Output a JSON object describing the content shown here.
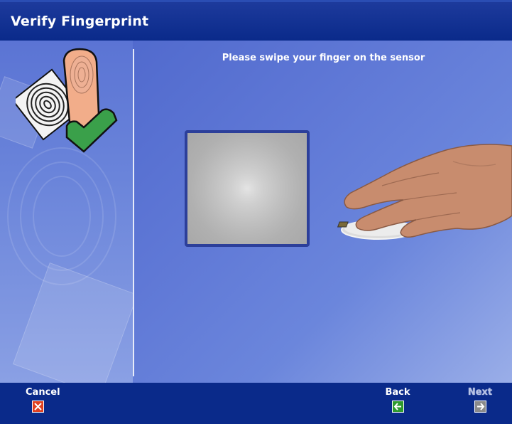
{
  "window": {
    "title": "Verify Fingerprint"
  },
  "main": {
    "instruction": "Please swipe your finger on the sensor"
  },
  "footer": {
    "cancel_label": "Cancel",
    "back_label": "Back",
    "next_label": "Next"
  },
  "colors": {
    "title_bar": "#0a2a8a",
    "content_bg": "#5f78d6",
    "sensor_border": "#2c3f9a",
    "cancel_icon": "#e04020",
    "back_icon": "#2e9a2e",
    "next_icon": "#8a8a8a"
  },
  "icons": {
    "header_art": "fingerprint-check-icon",
    "cancel": "close-icon",
    "back": "arrow-left-icon",
    "next": "arrow-right-icon"
  },
  "state": {
    "next_enabled": false
  }
}
